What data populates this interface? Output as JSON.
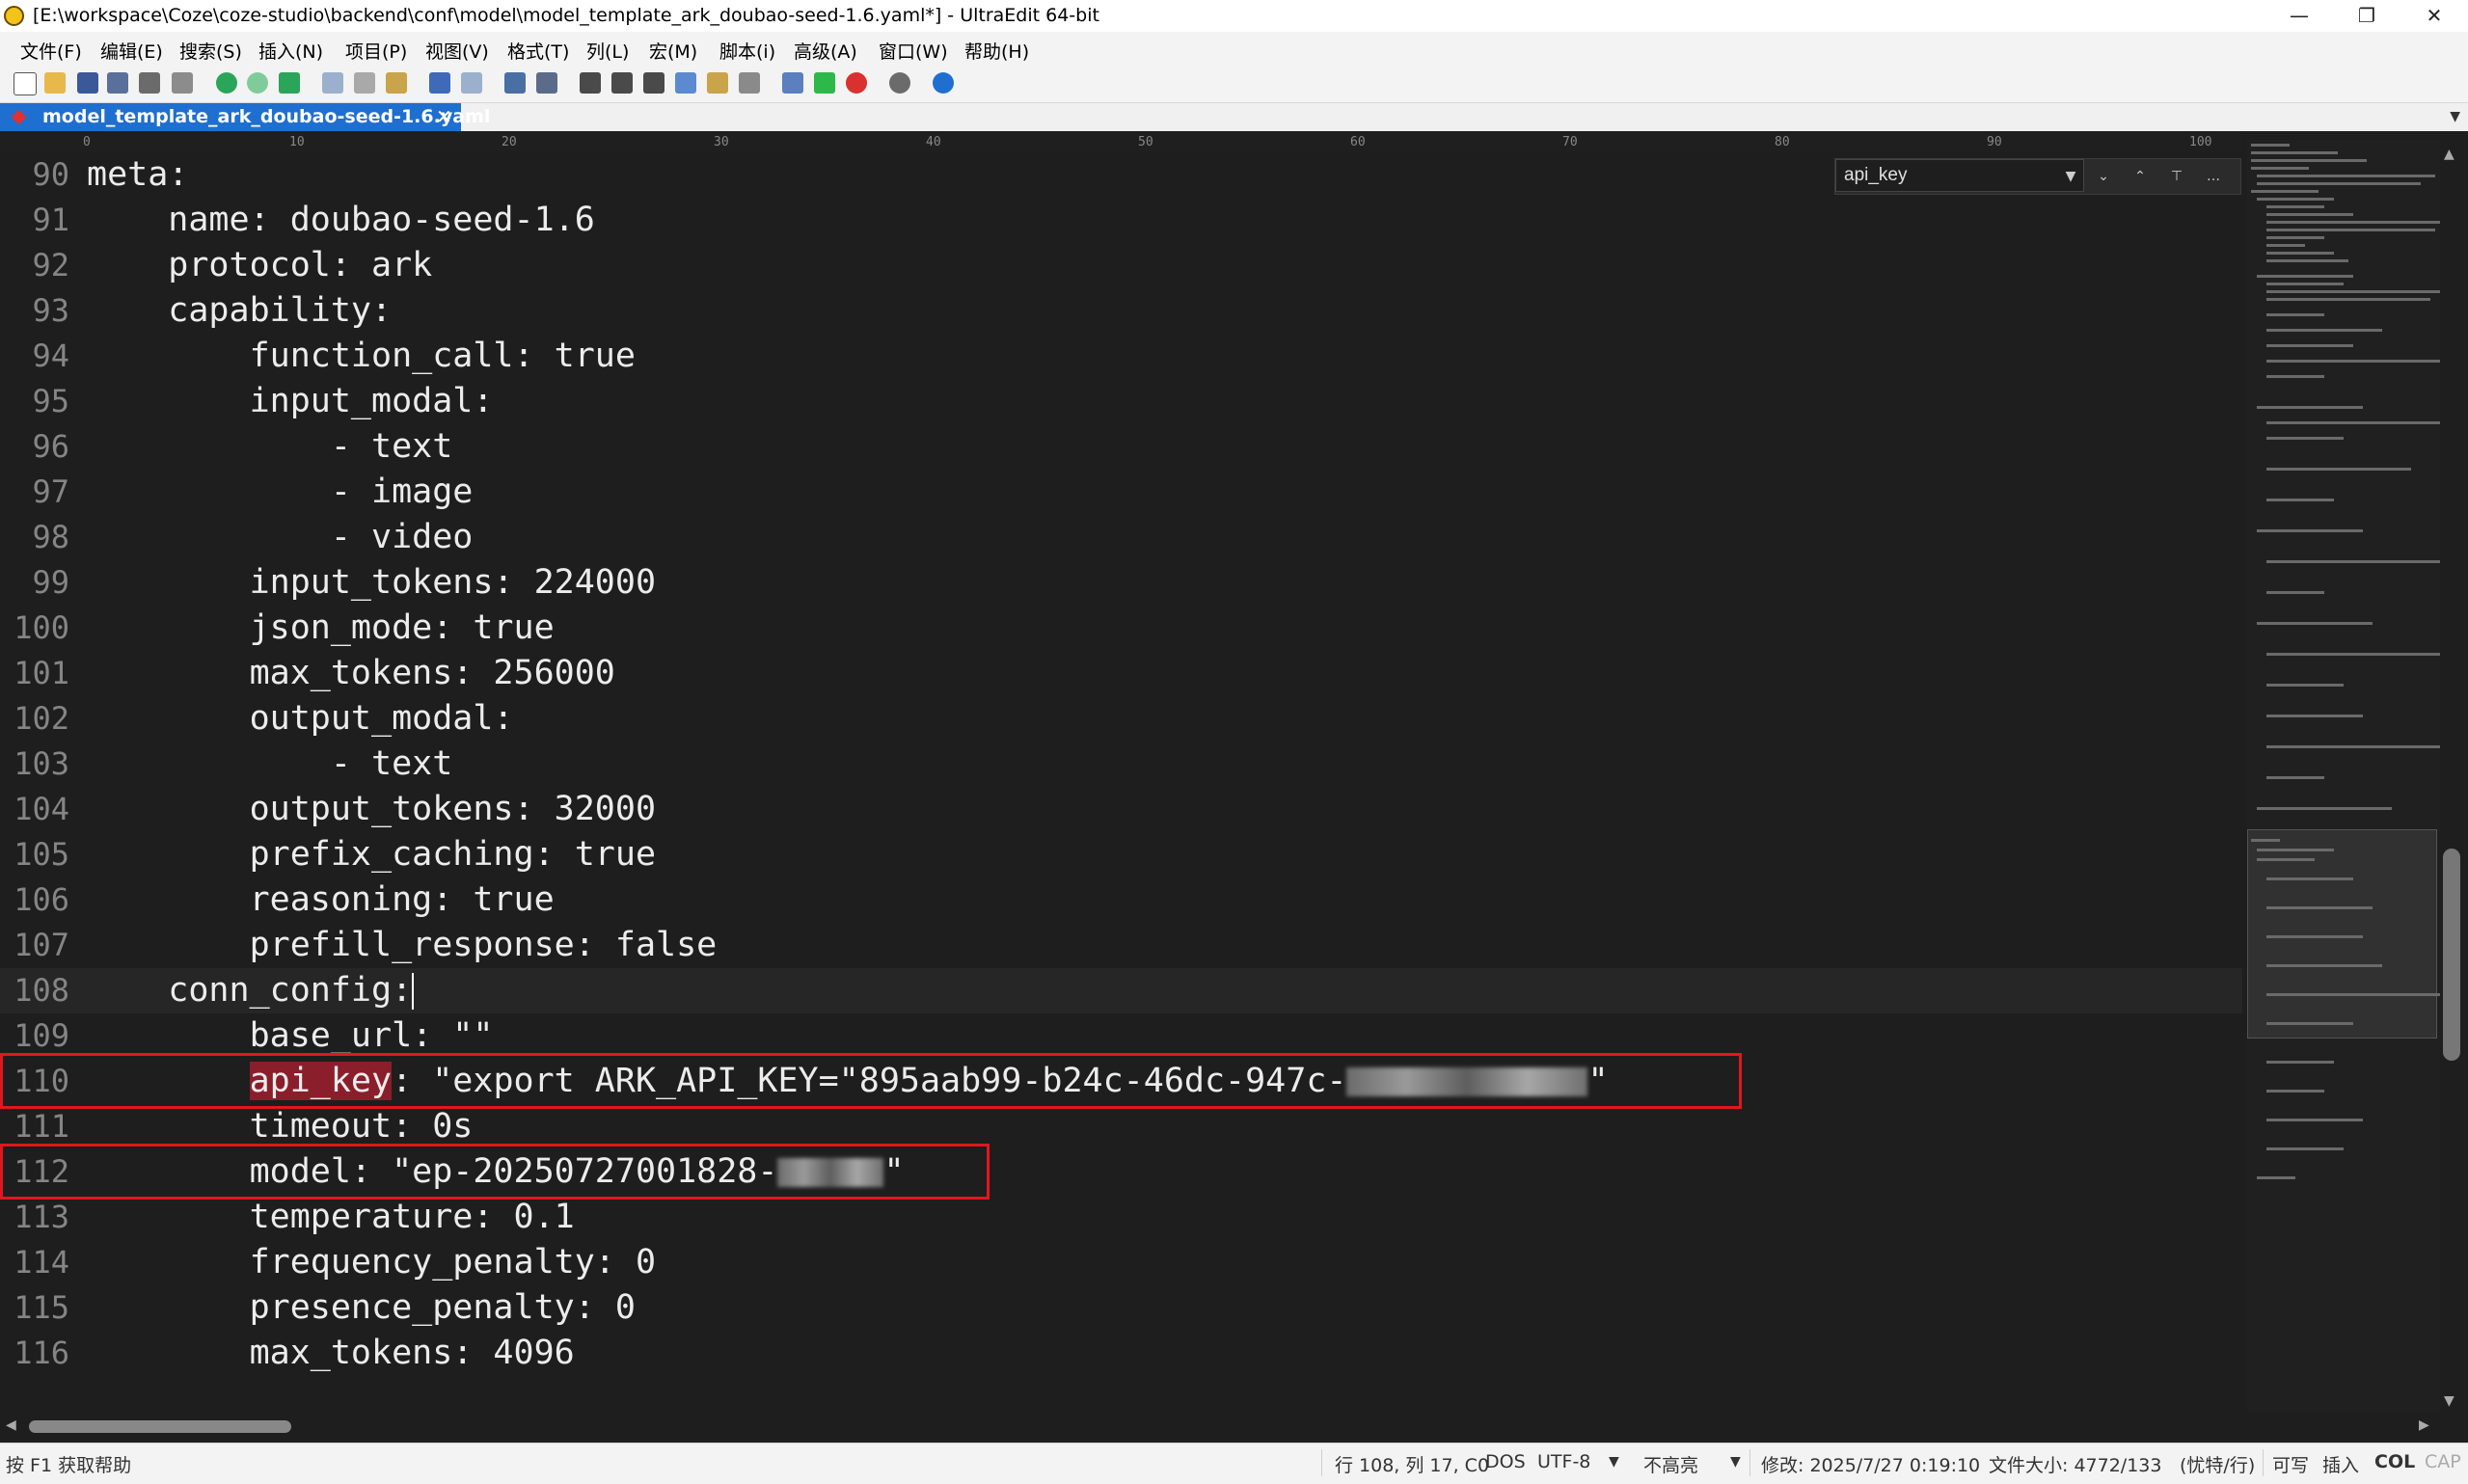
{
  "window": {
    "title": "[E:\\workspace\\Coze\\coze-studio\\backend\\conf\\model\\model_template_ark_doubao-seed-1.6.yaml*] - UltraEdit 64-bit",
    "minimize": "—",
    "maximize": "❐",
    "close": "✕"
  },
  "menu": [
    "文件(F)",
    "编辑(E)",
    "搜索(S)",
    "插入(N)",
    "项目(P)",
    "视图(V)",
    "格式(T)",
    "列(L)",
    "宏(M)",
    "脚本(i)",
    "高级(A)",
    "窗口(W)",
    "帮助(H)"
  ],
  "tab": {
    "label": "model_template_ark_doubao-seed-1.6.yaml",
    "close": "✕"
  },
  "ruler": [
    "0",
    "10",
    "20",
    "30",
    "40",
    "50",
    "60",
    "70",
    "80",
    "90",
    "100"
  ],
  "find": {
    "value": "api_key"
  },
  "lines": [
    {
      "n": "90",
      "text": "meta:"
    },
    {
      "n": "91",
      "text": "    name: doubao-seed-1.6"
    },
    {
      "n": "92",
      "text": "    protocol: ark"
    },
    {
      "n": "93",
      "text": "    capability:"
    },
    {
      "n": "94",
      "text": "        function_call: true"
    },
    {
      "n": "95",
      "text": "        input_modal:"
    },
    {
      "n": "96",
      "text": "            - text"
    },
    {
      "n": "97",
      "text": "            - image"
    },
    {
      "n": "98",
      "text": "            - video"
    },
    {
      "n": "99",
      "text": "        input_tokens: 224000"
    },
    {
      "n": "100",
      "text": "        json_mode: true"
    },
    {
      "n": "101",
      "text": "        max_tokens: 256000"
    },
    {
      "n": "102",
      "text": "        output_modal:"
    },
    {
      "n": "103",
      "text": "            - text"
    },
    {
      "n": "104",
      "text": "        output_tokens: 32000"
    },
    {
      "n": "105",
      "text": "        prefix_caching: true"
    },
    {
      "n": "106",
      "text": "        reasoning: true"
    },
    {
      "n": "107",
      "text": "        prefill_response: false"
    },
    {
      "n": "108",
      "text": "    conn_config:"
    },
    {
      "n": "109",
      "text": "        base_url: \"\""
    },
    {
      "n": "110",
      "indent": "        ",
      "key": "api_key",
      "rest": ": \"export ARK_API_KEY=\"895aab99-b24c-46dc-947c-",
      "tail": "\""
    },
    {
      "n": "111",
      "text": "        timeout: 0s"
    },
    {
      "n": "112",
      "text": "        model: \"ep-20250727001828-",
      "tail": "\""
    },
    {
      "n": "113",
      "text": "        temperature: 0.1"
    },
    {
      "n": "114",
      "text": "        frequency_penalty: 0"
    },
    {
      "n": "115",
      "text": "        presence_penalty: 0"
    },
    {
      "n": "116",
      "text": "        max_tokens: 4096"
    }
  ],
  "status": {
    "help": "按 F1 获取帮助",
    "position": "行 108, 列 17, C0",
    "line_ending": "DOS",
    "encoding": "UTF-8",
    "highlight": "不高亮",
    "modified": "修改:  2025/7/27 0:19:10",
    "filesize": "文件大小:  4772/133",
    "linemode": "(忧特/行)",
    "writable": "可写",
    "insert": "插入",
    "col": "COL",
    "cap": "CAP"
  },
  "colors": {
    "accent": "#1e6fd0",
    "highlight_redbox": "#e0171f",
    "search_match": "#8a1e2a"
  }
}
